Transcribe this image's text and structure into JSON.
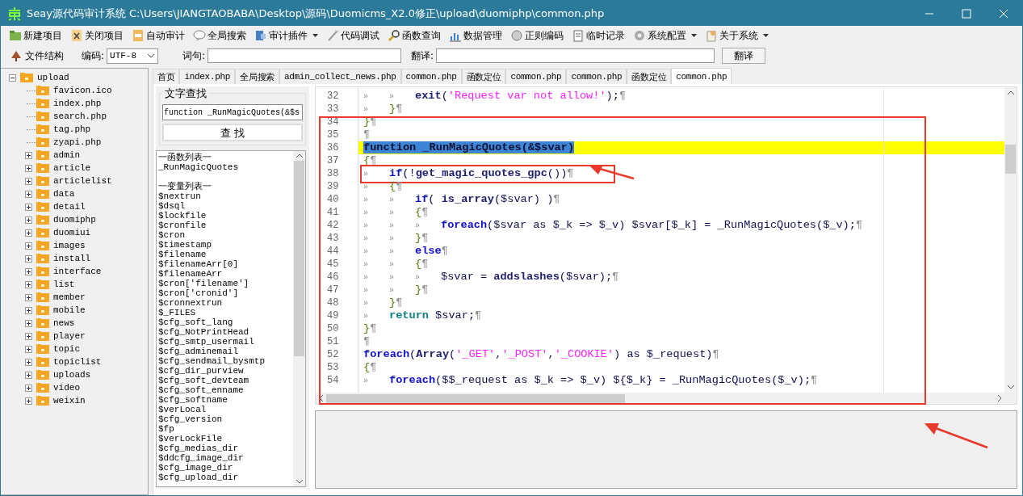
{
  "window": {
    "title": "Seay源代码审计系统  C:\\Users\\JIANGTAOBABA\\Desktop\\源码\\Duomicms_X2.0修正\\upload\\duomiphp\\common.php"
  },
  "toolbar": [
    {
      "label": "新建项目",
      "dropdown": false
    },
    {
      "label": "关闭项目",
      "dropdown": false
    },
    {
      "label": "自动审计",
      "dropdown": false
    },
    {
      "label": "全局搜索",
      "dropdown": false
    },
    {
      "label": "审计插件",
      "dropdown": true
    },
    {
      "label": "代码调试",
      "dropdown": false
    },
    {
      "label": "函数查询",
      "dropdown": false
    },
    {
      "label": "数据管理",
      "dropdown": false
    },
    {
      "label": "正则编码",
      "dropdown": false
    },
    {
      "label": "临时记录",
      "dropdown": false
    },
    {
      "label": "系统配置",
      "dropdown": true
    },
    {
      "label": "关于系统",
      "dropdown": true
    }
  ],
  "toolbar2": {
    "structure_label": "文件结构",
    "encoding_label": "编码:",
    "encoding": "UTF-8",
    "phrase_label": "词句:",
    "translate_label": "翻译:",
    "translate_button": "翻译"
  },
  "tree": [
    {
      "name": "upload",
      "expanded": true,
      "children": [
        {
          "name": "favicon.ico"
        },
        {
          "name": "index.php"
        },
        {
          "name": "search.php"
        },
        {
          "name": "tag.php"
        },
        {
          "name": "zyapi.php"
        },
        {
          "name": "admin",
          "expanded": false
        },
        {
          "name": "article",
          "expanded": false
        },
        {
          "name": "articlelist",
          "expanded": false
        },
        {
          "name": "data",
          "expanded": false
        },
        {
          "name": "detail",
          "expanded": false
        },
        {
          "name": "duomiphp",
          "expanded": false
        },
        {
          "name": "duomiui",
          "expanded": false
        },
        {
          "name": "images",
          "expanded": false
        },
        {
          "name": "install",
          "expanded": false
        },
        {
          "name": "interface",
          "expanded": false
        },
        {
          "name": "list",
          "expanded": false
        },
        {
          "name": "member",
          "expanded": false
        },
        {
          "name": "mobile",
          "expanded": false
        },
        {
          "name": "news",
          "expanded": false
        },
        {
          "name": "player",
          "expanded": false
        },
        {
          "name": "topic",
          "expanded": false
        },
        {
          "name": "topiclist",
          "expanded": false
        },
        {
          "name": "uploads",
          "expanded": false
        },
        {
          "name": "video",
          "expanded": false
        },
        {
          "name": "weixin",
          "expanded": false
        }
      ]
    }
  ],
  "tabs": [
    {
      "label": "首页",
      "selected": false
    },
    {
      "label": "index.php",
      "selected": false
    },
    {
      "label": "全局搜索",
      "selected": false
    },
    {
      "label": "admin_collect_news.php",
      "selected": false
    },
    {
      "label": "common.php",
      "selected": false
    },
    {
      "label": "函数定位",
      "selected": false
    },
    {
      "label": "common.php",
      "selected": false
    },
    {
      "label": "common.php",
      "selected": false
    },
    {
      "label": "函数定位",
      "selected": false
    },
    {
      "label": "common.php",
      "selected": true
    }
  ],
  "search": {
    "group_title": "文字查找",
    "value": "function _RunMagicQuotes(&$s",
    "button": "查 找"
  },
  "symbol_list": [
    {
      "heading": "一函数列表一",
      "items": [
        "_RunMagicQuotes"
      ]
    },
    {
      "heading": "一变量列表一",
      "items": [
        "$nextrun",
        "$dsql",
        "$lockfile",
        "$cronfile",
        "$cron",
        "$timestamp",
        "$filename",
        "$filenameArr[0]",
        "$filenameArr",
        "$cron['filename']",
        "$cron['cronid']",
        "$cronnextrun",
        "$_FILES",
        "$cfg_soft_lang",
        "$cfg_NotPrintHead",
        "$cfg_smtp_usermail",
        "$cfg_adminemail",
        "$cfg_sendmail_bysmtp",
        "$cfg_dir_purview",
        "$cfg_soft_devteam",
        "$cfg_soft_enname",
        "$cfg_softname",
        "$verLocal",
        "$cfg_version",
        "$fp",
        "$verLockFile",
        "$cfg_medias_dir",
        "$ddcfg_image_dir",
        "$cfg_image_dir",
        "$cfg_upload_dir"
      ]
    }
  ],
  "code": [
    {
      "number": "32",
      "tokens": [
        {
          "kind": "tab",
          "text": "»"
        },
        {
          "kind": "tab",
          "text": "»"
        },
        {
          "kind": "fn",
          "text": "exit"
        },
        {
          "kind": "plain",
          "text": "("
        },
        {
          "kind": "str",
          "text": "'Request var not allow!'"
        },
        {
          "kind": "plain",
          "text": ");"
        },
        {
          "kind": "pilcrow",
          "text": "¶"
        }
      ]
    },
    {
      "number": "33",
      "tokens": [
        {
          "kind": "tab",
          "text": "»"
        },
        {
          "kind": "brace",
          "text": "}"
        },
        {
          "kind": "pilcrow",
          "text": "¶"
        }
      ]
    },
    {
      "number": "34",
      "tokens": [
        {
          "kind": "brace",
          "text": "}"
        },
        {
          "kind": "pilcrow",
          "text": "¶"
        }
      ]
    },
    {
      "number": "35",
      "tokens": [
        {
          "kind": "pilcrow",
          "text": "¶"
        }
      ]
    },
    {
      "number": "36",
      "highlighted": true,
      "tokens": [
        {
          "kind": "selected",
          "text": "function _RunMagicQuotes(&$svar)"
        }
      ]
    },
    {
      "number": "37",
      "tokens": [
        {
          "kind": "brace",
          "text": "{"
        },
        {
          "kind": "pilcrow",
          "text": "¶"
        }
      ]
    },
    {
      "number": "38",
      "boxed": true,
      "tokens": [
        {
          "kind": "tab",
          "text": "»"
        },
        {
          "kind": "kw",
          "text": "if"
        },
        {
          "kind": "plain",
          "text": "(!"
        },
        {
          "kind": "fn",
          "text": "get_magic_quotes_gpc"
        },
        {
          "kind": "plain",
          "text": "())"
        },
        {
          "kind": "pilcrow",
          "text": "¶"
        }
      ]
    },
    {
      "number": "39",
      "tokens": [
        {
          "kind": "tab",
          "text": "»"
        },
        {
          "kind": "brace",
          "text": "{"
        },
        {
          "kind": "pilcrow",
          "text": "¶"
        }
      ]
    },
    {
      "number": "40",
      "tokens": [
        {
          "kind": "tab",
          "text": "»"
        },
        {
          "kind": "tab",
          "text": "»"
        },
        {
          "kind": "kw",
          "text": "if"
        },
        {
          "kind": "plain",
          "text": "( "
        },
        {
          "kind": "fn",
          "text": "is_array"
        },
        {
          "kind": "plain",
          "text": "($svar) )"
        },
        {
          "kind": "pilcrow",
          "text": "¶"
        }
      ]
    },
    {
      "number": "41",
      "tokens": [
        {
          "kind": "tab",
          "text": "»"
        },
        {
          "kind": "tab",
          "text": "»"
        },
        {
          "kind": "brace",
          "text": "{"
        },
        {
          "kind": "pilcrow",
          "text": "¶"
        }
      ]
    },
    {
      "number": "42",
      "tokens": [
        {
          "kind": "tab",
          "text": "»"
        },
        {
          "kind": "tab",
          "text": "»"
        },
        {
          "kind": "tab",
          "text": "»"
        },
        {
          "kind": "kw",
          "text": "foreach"
        },
        {
          "kind": "plain",
          "text": "($svar as $_k => $_v) $svar[$_k] = _RunMagicQuotes($_v);"
        },
        {
          "kind": "pilcrow",
          "text": "¶"
        }
      ]
    },
    {
      "number": "43",
      "tokens": [
        {
          "kind": "tab",
          "text": "»"
        },
        {
          "kind": "tab",
          "text": "»"
        },
        {
          "kind": "brace",
          "text": "}"
        },
        {
          "kind": "pilcrow",
          "text": "¶"
        }
      ]
    },
    {
      "number": "44",
      "tokens": [
        {
          "kind": "tab",
          "text": "»"
        },
        {
          "kind": "tab",
          "text": "»"
        },
        {
          "kind": "kw",
          "text": "else"
        },
        {
          "kind": "pilcrow",
          "text": "¶"
        }
      ]
    },
    {
      "number": "45",
      "tokens": [
        {
          "kind": "tab",
          "text": "»"
        },
        {
          "kind": "tab",
          "text": "»"
        },
        {
          "kind": "brace",
          "text": "{"
        },
        {
          "kind": "pilcrow",
          "text": "¶"
        }
      ]
    },
    {
      "number": "46",
      "tokens": [
        {
          "kind": "tab",
          "text": "»"
        },
        {
          "kind": "tab",
          "text": "»"
        },
        {
          "kind": "tab",
          "text": "»"
        },
        {
          "kind": "plain",
          "text": "$svar = "
        },
        {
          "kind": "fn",
          "text": "addslashes"
        },
        {
          "kind": "plain",
          "text": "($svar);"
        },
        {
          "kind": "pilcrow",
          "text": "¶"
        }
      ]
    },
    {
      "number": "47",
      "tokens": [
        {
          "kind": "tab",
          "text": "»"
        },
        {
          "kind": "tab",
          "text": "»"
        },
        {
          "kind": "brace",
          "text": "}"
        },
        {
          "kind": "pilcrow",
          "text": "¶"
        }
      ]
    },
    {
      "number": "48",
      "tokens": [
        {
          "kind": "tab",
          "text": "»"
        },
        {
          "kind": "brace",
          "text": "}"
        },
        {
          "kind": "pilcrow",
          "text": "¶"
        }
      ]
    },
    {
      "number": "49",
      "tokens": [
        {
          "kind": "tab",
          "text": "»"
        },
        {
          "kind": "ret",
          "text": "return"
        },
        {
          "kind": "plain",
          "text": " $svar;"
        },
        {
          "kind": "pilcrow",
          "text": "¶"
        }
      ]
    },
    {
      "number": "50",
      "tokens": [
        {
          "kind": "brace",
          "text": "}"
        },
        {
          "kind": "pilcrow",
          "text": "¶"
        }
      ]
    },
    {
      "number": "51",
      "tokens": [
        {
          "kind": "pilcrow",
          "text": "¶"
        }
      ]
    },
    {
      "number": "52",
      "tokens": [
        {
          "kind": "kw",
          "text": "foreach"
        },
        {
          "kind": "plain",
          "text": "("
        },
        {
          "kind": "fn",
          "text": "Array"
        },
        {
          "kind": "plain",
          "text": "("
        },
        {
          "kind": "str",
          "text": "'_GET'"
        },
        {
          "kind": "plain",
          "text": ","
        },
        {
          "kind": "str",
          "text": "'_POST'"
        },
        {
          "kind": "plain",
          "text": ","
        },
        {
          "kind": "str",
          "text": "'_COOKIE'"
        },
        {
          "kind": "plain",
          "text": ") as $_request)"
        },
        {
          "kind": "pilcrow",
          "text": "¶"
        }
      ]
    },
    {
      "number": "53",
      "tokens": [
        {
          "kind": "brace",
          "text": "{"
        },
        {
          "kind": "pilcrow",
          "text": "¶"
        }
      ]
    },
    {
      "number": "54",
      "tokens": [
        {
          "kind": "tab",
          "text": "»"
        },
        {
          "kind": "kw",
          "text": "foreach"
        },
        {
          "kind": "plain",
          "text": "($$_request as $_k => $_v) ${$_k} = _RunMagicQuotes($_v);"
        },
        {
          "kind": "pilcrow",
          "text": "¶"
        }
      ]
    }
  ],
  "annotation": {
    "frame": true,
    "arrows": true
  }
}
